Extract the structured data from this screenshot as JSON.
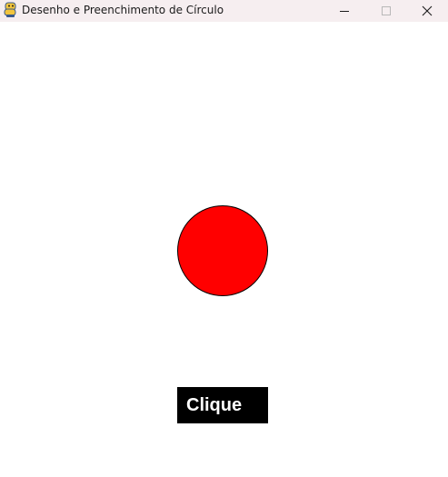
{
  "window": {
    "title": "Desenho e Preenchimento de Círculo",
    "icon": "pygame-snake-icon",
    "controls": [
      "minimize-icon",
      "maximize-icon",
      "close-icon"
    ]
  },
  "canvas": {
    "background": "#ffffff",
    "circle": {
      "fill": "#ff0000",
      "stroke": "#000000",
      "filled": true
    },
    "button": {
      "label": "Clique",
      "background": "#000000",
      "text_color": "#ffffff"
    }
  }
}
